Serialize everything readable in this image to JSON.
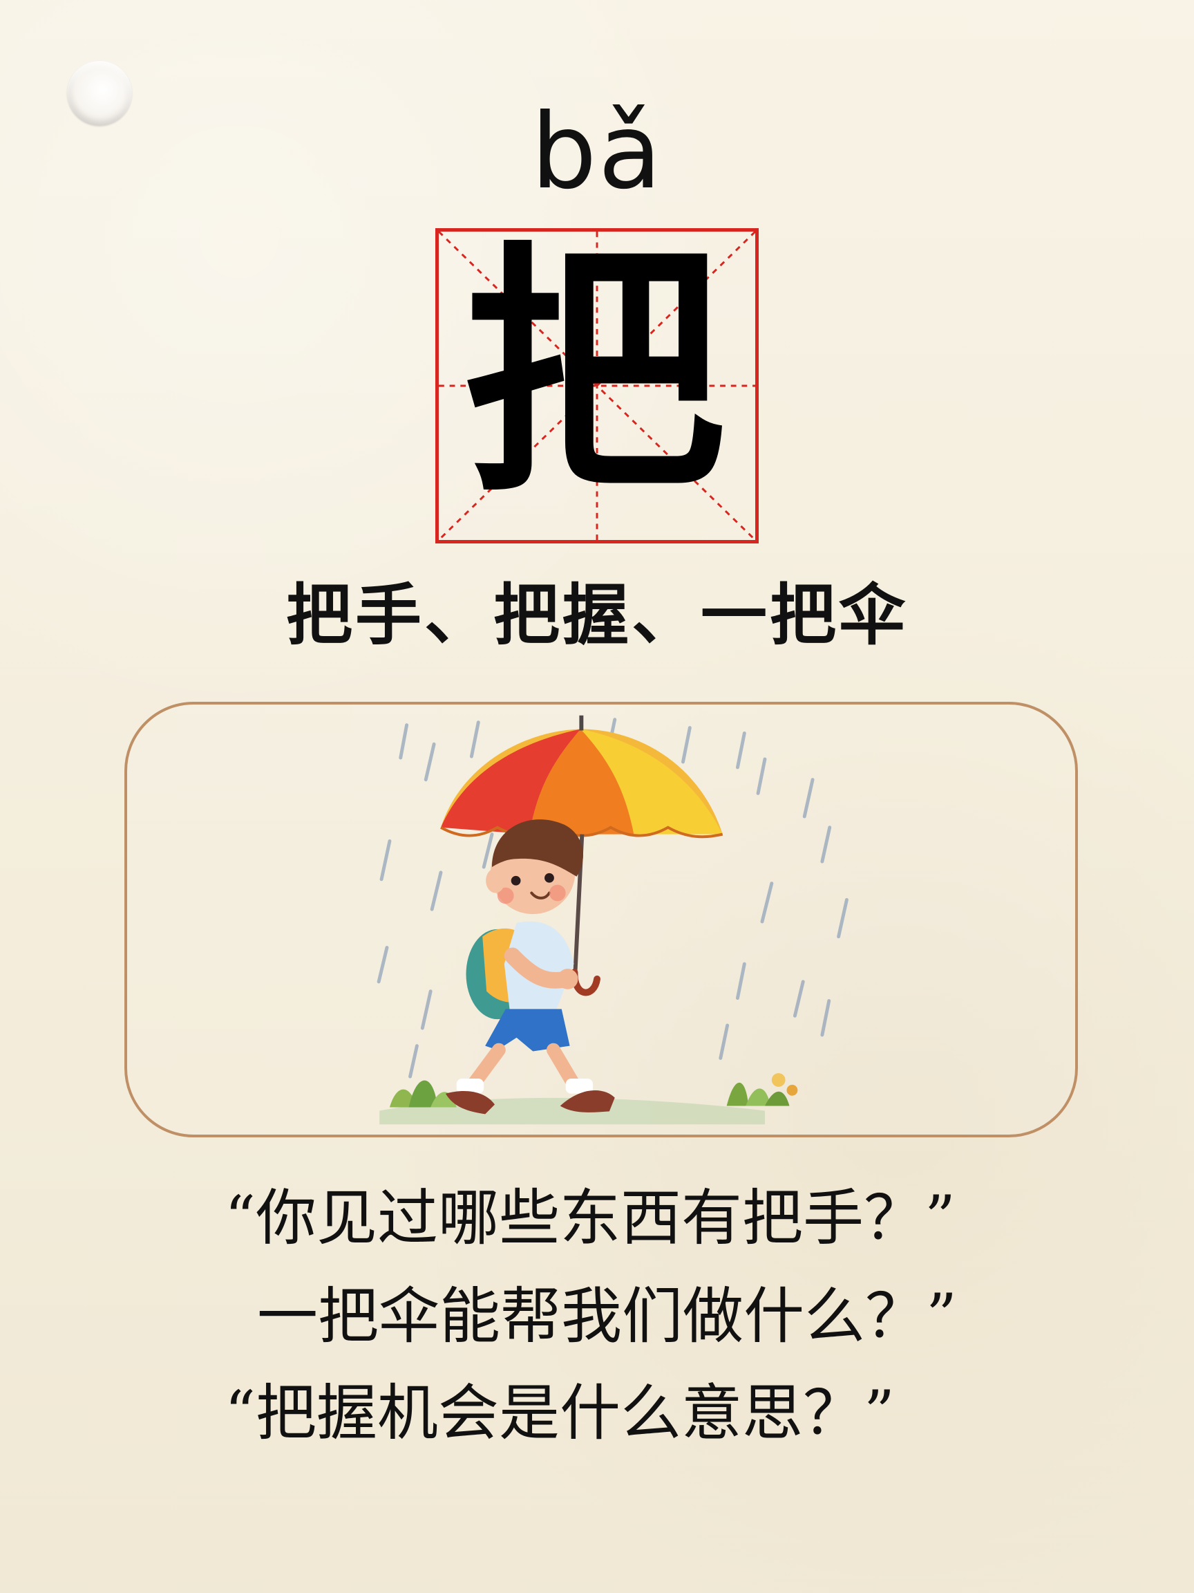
{
  "pinyin": "bǎ",
  "character": "把",
  "words": "把手、把握、一把伞",
  "questions": [
    "“你见过哪些东西有把手？”",
    "一把伞能帮我们做什么？”",
    "“把握机会是什么意思？”"
  ],
  "colors": {
    "background": "#f6f0df",
    "grid_red": "#d7261f",
    "frame_brown": "#bf8f66"
  },
  "illustration": {
    "subject": "boy walking in the rain with an umbrella"
  }
}
